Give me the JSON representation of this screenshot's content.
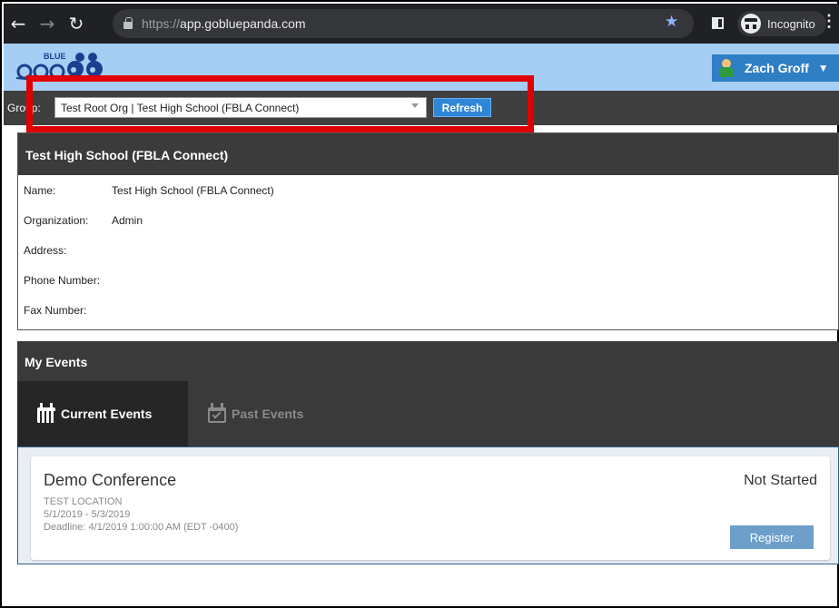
{
  "browser": {
    "url_scheme": "https://",
    "url_host": "app.gobluepanda.com",
    "incognito_label": "Incognito"
  },
  "header": {
    "logo_text": "BLUE",
    "user_name": "Zach Groff"
  },
  "group_bar": {
    "label": "Group:",
    "selected_group": "Test Root Org | Test High School (FBLA Connect)",
    "refresh_label": "Refresh"
  },
  "school": {
    "title": "Test High School (FBLA Connect)",
    "rows": [
      {
        "label": "Name:",
        "value": "Test High School (FBLA Connect)"
      },
      {
        "label": "Organization:",
        "value": "Admin"
      },
      {
        "label": "Address:",
        "value": ""
      },
      {
        "label": "Phone Number:",
        "value": ""
      },
      {
        "label": "Fax Number:",
        "value": ""
      }
    ]
  },
  "events": {
    "title": "My Events",
    "tabs": [
      {
        "label": "Current Events",
        "active": true
      },
      {
        "label": "Past Events",
        "active": false
      }
    ],
    "items": [
      {
        "name": "Demo Conference",
        "location": "TEST LOCATION",
        "dates": "5/1/2019 - 5/3/2019",
        "deadline": "Deadline: 4/1/2019 1:00:00 AM (EDT -0400)",
        "status": "Not Started",
        "action_label": "Register"
      }
    ]
  },
  "colors": {
    "accent": "#2f86d6",
    "header_bg": "#a6cef5",
    "highlight": "#e00000"
  }
}
